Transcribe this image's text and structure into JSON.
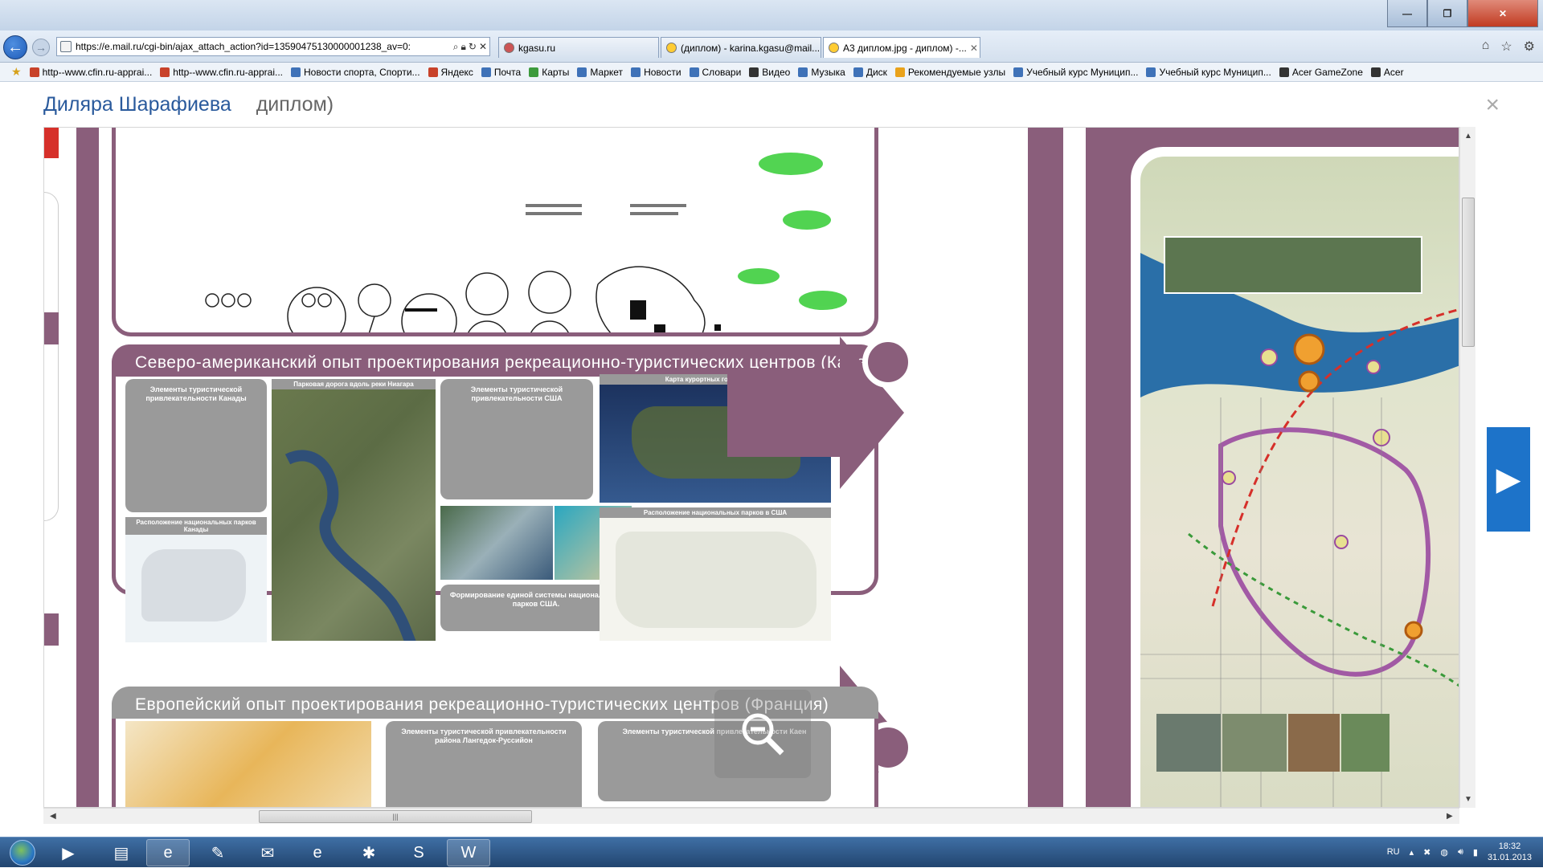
{
  "browser": {
    "address": "https://e.mail.ru/cgi-bin/ajax_attach_action?id=13590475130000001238_av=0:",
    "tabs": [
      {
        "label": "kgasu.ru",
        "active": false
      },
      {
        "label": "(диплом) - karina.kgasu@mail....",
        "active": false
      },
      {
        "label": "А3 диплом.jpg - диплом) -...",
        "active": true
      }
    ],
    "favorites": [
      "http--www.cfin.ru-apprai...",
      "http--www.cfin.ru-apprai...",
      "Новости спорта, Спорти...",
      "Яндекс",
      "Почта",
      "Карты",
      "Маркет",
      "Новости",
      "Словари",
      "Видео",
      "Музыка",
      "Диск",
      "Рекомендуемые узлы",
      "Учебный курс Муницип...",
      "Учебный курс Муницип...",
      "Acer GameZone",
      "Acer"
    ]
  },
  "viewer": {
    "sender": "Диляра Шарафиева",
    "subject": "диплом)",
    "close": "×",
    "next": "▶"
  },
  "poster": {
    "north_america_title": "Северо-американский опыт проектирования рекреационно-туристических центров (Канада, США)",
    "europe_title": "Европейский опыт проектирования рекреационно-туристических центров (Франция)",
    "canada_box_title": "Элементы туристической привлекательности Канады",
    "niagara_caption": "Парковая дорога вдоль реки Ниагара",
    "usa_box_title": "Элементы туристической привлекательности США",
    "resort_map_caption": "Карта курортных городов США",
    "canada_parks_caption": "Расположение национальных парков Канады",
    "usa_parks_caption": "Расположение национальных парков в США",
    "usa_parks_system": "Формирование единой системы национальных парков США.",
    "languedoc_title": "Элементы туристической привлекательности района Лангедок-Руссийон",
    "caen_title": "Элементы туристической привлекательности Каен"
  },
  "taskbar": {
    "lang": "RU",
    "time": "18:32",
    "date": "31.01.2013"
  },
  "colors": {
    "accent": "#8a5e7b",
    "viewer_next": "#1d73c9",
    "taskbar": "#2b5486"
  }
}
